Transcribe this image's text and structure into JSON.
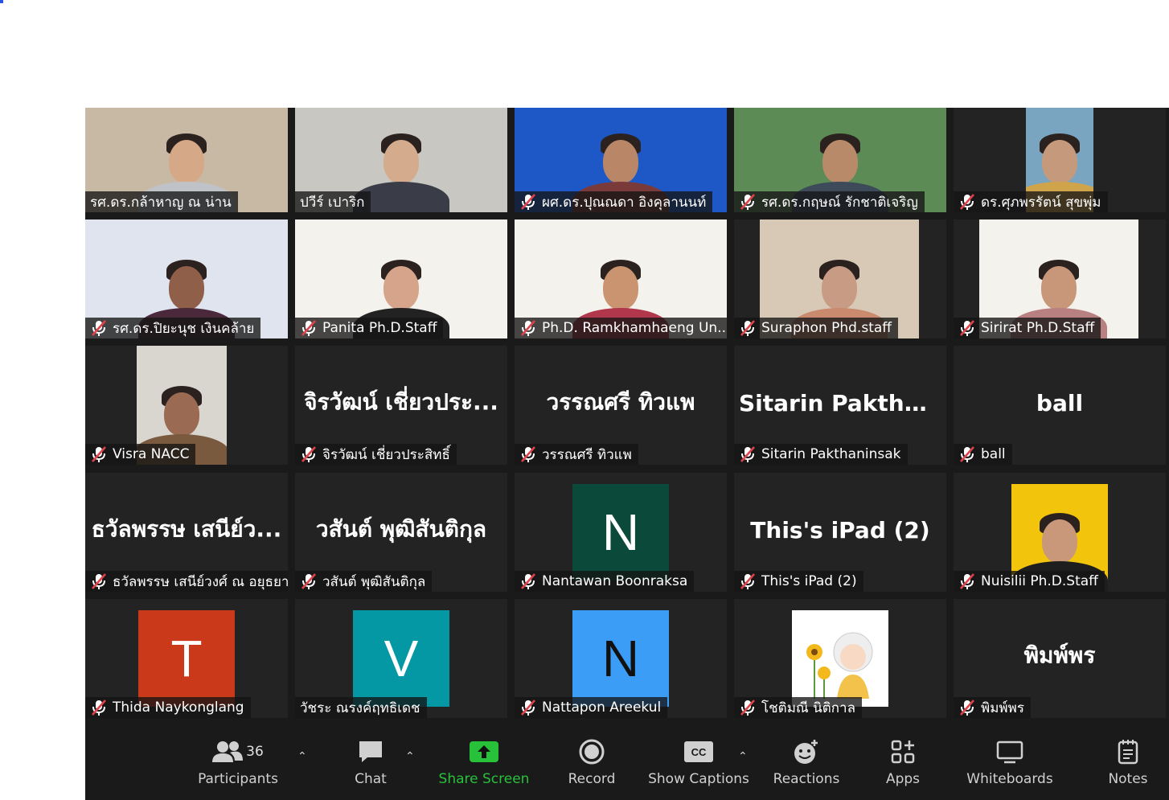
{
  "participants": [
    {
      "name": "รศ.ดร.กล้าหาญ  ณ น่าน",
      "type": "video",
      "muted": false,
      "active": true,
      "skin": "#d5a888",
      "shirt": "#bfc3c7",
      "bg": "#c8b9a4"
    },
    {
      "name": "ปวีร์ เปาริก",
      "type": "video",
      "muted": false,
      "skin": "#d4ab8c",
      "shirt": "#3a3d48",
      "bg": "#c9c7c2"
    },
    {
      "name": "ผศ.ดร.ปุณณดา อิงคุลานนท์",
      "type": "video",
      "muted": true,
      "skin": "#b98767",
      "shirt": "#7a3a3a",
      "bg": "#1e58c6"
    },
    {
      "name": "รศ.ดร.กฤษณ์ รักชาติเจริญ",
      "type": "video",
      "muted": true,
      "skin": "#b88a6a",
      "shirt": "#3c4a5a",
      "bg": "#5c8b55"
    },
    {
      "name": "ดร.ศุภพรรัตน์ สุขพุ่ม",
      "type": "video",
      "muted": true,
      "skin": "#c59a7c",
      "shirt": "#d0a44a",
      "bg": "#7aa5c0"
    },
    {
      "name": "รศ.ดร.ปิยะนุช เงินคล้าย",
      "type": "video",
      "muted": true,
      "skin": "#8f5f4a",
      "shirt": "#4a2a3a",
      "bg": "#dfe4ee"
    },
    {
      "name": "Panita Ph.D.Staff",
      "type": "video",
      "muted": true,
      "skin": "#d6a48a",
      "shirt": "#222222",
      "bg": "#f4f2ec"
    },
    {
      "name": "Ph.D. Ramkhamhaeng Un...",
      "type": "video",
      "muted": true,
      "skin": "#c9946f",
      "shirt": "#b0374c",
      "bg": "#f4f2ec"
    },
    {
      "name": "Suraphon Phd.staff",
      "type": "video",
      "muted": true,
      "skin": "#c89c84",
      "shirt": "#c98a6e",
      "bg": "#d8c9b6"
    },
    {
      "name": "Sirirat Ph.D.Staff",
      "type": "video",
      "muted": true,
      "skin": "#c8977a",
      "shirt": "#b98082",
      "bg": "#f4f2ec"
    },
    {
      "name": "Visra NACC",
      "type": "video",
      "muted": true,
      "skin": "#9a6a52",
      "shirt": "#7a5a3e",
      "bg": "#d9d6cf"
    },
    {
      "name": "จิรวัฒน์ เชี่ยวประสิทธิ์",
      "type": "text",
      "muted": true,
      "display": "จิรวัฒน์ เชี่ยวประ..."
    },
    {
      "name": "วรรณศรี  ทิวแพ",
      "type": "text",
      "muted": true,
      "display": "วรรณศรี  ทิวแพ"
    },
    {
      "name": "Sitarin Pakthaninsak",
      "type": "text",
      "muted": true,
      "display": "Sitarin  Pakthani..."
    },
    {
      "name": "ball",
      "type": "text",
      "muted": true,
      "display": "ball"
    },
    {
      "name": "ธวัลพรรษ เสนีย์วงศ์ ณ อยุธยา",
      "type": "text",
      "muted": true,
      "display": "ธวัลพรรษ เสนีย์ว..."
    },
    {
      "name": "วสันต์ พุฒิสันติกุล",
      "type": "text",
      "muted": true,
      "display": "วสันต์ พุฒิสันติกุล"
    },
    {
      "name": "Nantawan Boonraksa",
      "type": "avatar",
      "muted": true,
      "letter": "N",
      "color": "#0b4a3a"
    },
    {
      "name": "This's iPad (2)",
      "type": "text",
      "muted": true,
      "display": "This's iPad (2)"
    },
    {
      "name": "Nuisilii Ph.D.Staff",
      "type": "video",
      "muted": true,
      "skin": "#c9987a",
      "shirt": "#1e1e1e",
      "bg": "#f2c40c",
      "small": true
    },
    {
      "name": "Thida Naykonglang",
      "type": "avatar",
      "muted": true,
      "letter": "T",
      "color": "#c9391a"
    },
    {
      "name": "วัชระ ณรงค์ฤทธิเดช",
      "type": "avatar",
      "muted": false,
      "letter": "V",
      "color": "#0398a3"
    },
    {
      "name": "Nattapon Areekul",
      "type": "avatar",
      "muted": true,
      "letter": "N",
      "color": "#3b9df5",
      "dark": true
    },
    {
      "name": "โชติมณี นิติกาล",
      "type": "picture",
      "muted": true
    },
    {
      "name": "พิมพ์พร",
      "type": "text",
      "muted": true,
      "display": "พิมพ์พร"
    }
  ],
  "toolbar": {
    "participants_label": "Participants",
    "participants_count": "36",
    "chat_label": "Chat",
    "share_label": "Share Screen",
    "record_label": "Record",
    "captions_label": "Show Captions",
    "captions_icon_text": "CC",
    "reactions_label": "Reactions",
    "apps_label": "Apps",
    "whiteboards_label": "Whiteboards",
    "notes_label": "Notes"
  },
  "colors": {
    "accent_green": "#27c13a",
    "active_speaker": "#a6e04a",
    "muted_red": "#e0424b"
  }
}
